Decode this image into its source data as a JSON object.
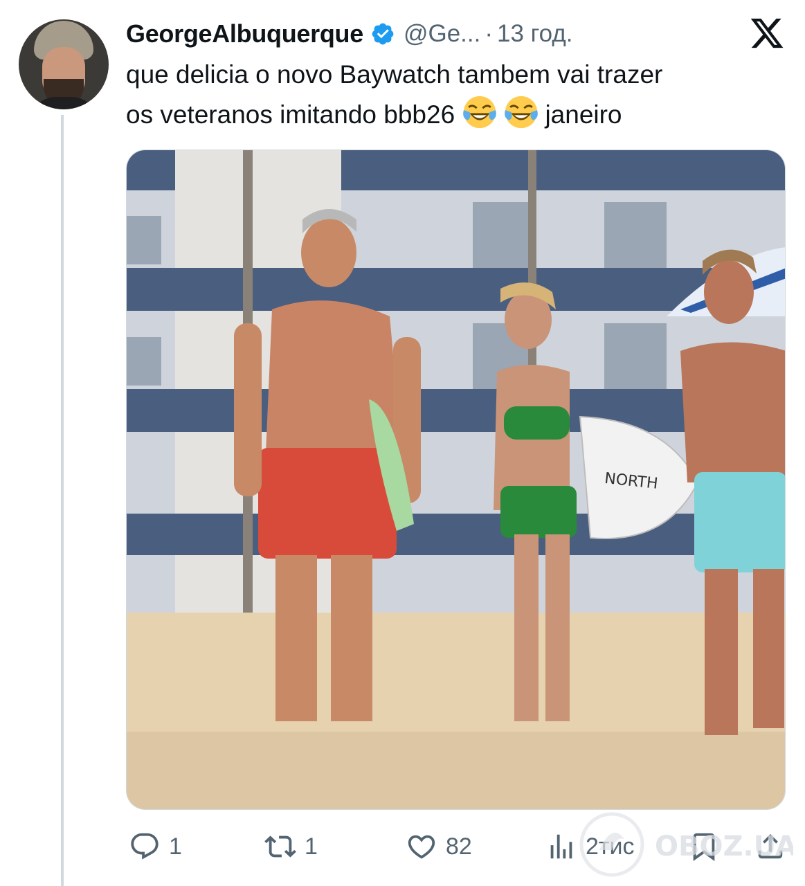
{
  "tweet": {
    "author": {
      "display_name": "GeorgeAlbuquerque",
      "handle": "@Ge...",
      "verified": true
    },
    "separator": "·",
    "time": "13 год.",
    "text_line1": "que delicia o novo Baywatch tambem vai trazer",
    "text_line2_before": "os veteranos imitando bbb26",
    "text_line2_after": "janeiro",
    "emojis": [
      "face-with-tears-of-joy",
      "face-with-tears-of-joy"
    ],
    "media": {
      "board_text": "NORTH"
    }
  },
  "actions": {
    "reply_count": "1",
    "repost_count": "1",
    "like_count": "82",
    "views_count": "2тис"
  },
  "watermark": {
    "text": "OBOZ.UA"
  },
  "colors": {
    "verified": "#1d9bf0",
    "secondary_text": "#536471",
    "thread_line": "#cfd9de",
    "sand": "#e7d2b0",
    "building_blue": "#4a5e80"
  },
  "icons": [
    "verified-badge-icon",
    "x-logo-icon",
    "reply-icon",
    "repost-icon",
    "like-icon",
    "views-icon",
    "bookmark-icon",
    "share-icon"
  ]
}
